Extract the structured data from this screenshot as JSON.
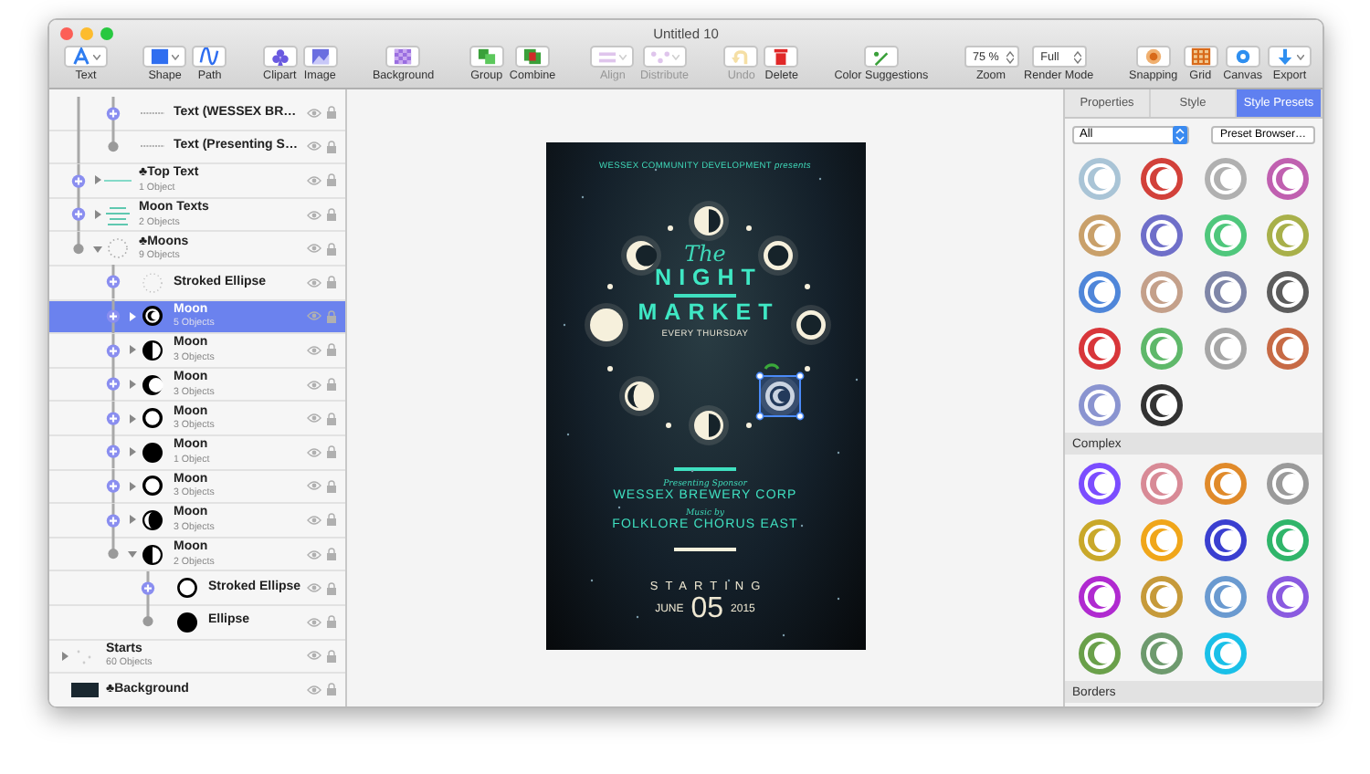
{
  "window": {
    "title": "Untitled 10"
  },
  "toolbar": [
    {
      "items": [
        {
          "kind": "dropdown",
          "label": "Text",
          "disabled": false
        }
      ]
    },
    {
      "items": [
        {
          "kind": "dropdown",
          "label": "Shape",
          "disabled": false
        },
        {
          "kind": "button",
          "label": "Path",
          "disabled": false
        }
      ]
    },
    {
      "items": [
        {
          "kind": "button",
          "label": "Clipart",
          "disabled": false
        },
        {
          "kind": "button",
          "label": "Image",
          "disabled": false
        }
      ]
    },
    {
      "items": [
        {
          "kind": "button",
          "label": "Background",
          "disabled": false
        }
      ]
    },
    {
      "items": [
        {
          "kind": "button",
          "label": "Group",
          "disabled": false
        },
        {
          "kind": "button",
          "label": "Combine",
          "disabled": false
        }
      ]
    },
    {
      "items": [
        {
          "kind": "dropdown",
          "label": "Align",
          "disabled": true
        },
        {
          "kind": "dropdown",
          "label": "Distribute",
          "disabled": true
        }
      ]
    },
    {
      "items": [
        {
          "kind": "button",
          "label": "Undo",
          "disabled": true
        },
        {
          "kind": "button",
          "label": "Delete",
          "disabled": false
        }
      ]
    },
    {
      "items": [
        {
          "kind": "button",
          "label": "Color Suggestions",
          "disabled": false
        }
      ]
    },
    {
      "items": [
        {
          "kind": "stepper",
          "label": "Zoom",
          "value": "75 %"
        },
        {
          "kind": "stepper",
          "label": "Render Mode",
          "value": "Full"
        }
      ]
    },
    {
      "items": [
        {
          "kind": "button",
          "label": "Snapping",
          "disabled": false
        },
        {
          "kind": "button",
          "label": "Grid",
          "disabled": false
        },
        {
          "kind": "button",
          "label": "Canvas",
          "disabled": false
        },
        {
          "kind": "dropdown",
          "label": "Export",
          "disabled": false
        }
      ]
    }
  ],
  "layers": [
    {
      "kind": "offscreen",
      "children": [
        {
          "kind": "offscreen",
          "children": [
            {
              "kind": "text",
              "name": "Text (WESSEX BR…",
              "selected": false
            },
            {
              "kind": "text",
              "name": "Text (Presenting S…",
              "selected": false
            }
          ]
        },
        {
          "kind": "line-group",
          "name": "♣Top Text",
          "count": "1 Object",
          "expanded": false,
          "selected": false
        },
        {
          "kind": "text-group",
          "name": "Moon Texts",
          "count": "2 Objects",
          "expanded": false,
          "selected": false
        },
        {
          "kind": "moon-group",
          "name": "♣Moons",
          "count": "9 Objects",
          "expanded": true,
          "selected": false,
          "children": [
            {
              "kind": "stroked-ellipse",
              "name": "Stroked Ellipse",
              "selected": false
            },
            {
              "kind": "moon",
              "name": "Moon",
              "count": "5 Objects",
              "expanded": false,
              "selected": true
            },
            {
              "kind": "moon",
              "name": "Moon",
              "count": "3 Objects",
              "expanded": false,
              "selected": false
            },
            {
              "kind": "moon",
              "name": "Moon",
              "count": "3 Objects",
              "expanded": false,
              "selected": false
            },
            {
              "kind": "moon",
              "name": "Moon",
              "count": "3 Objects",
              "expanded": false,
              "selected": false
            },
            {
              "kind": "moon",
              "name": "Moon",
              "count": "1 Object",
              "expanded": false,
              "selected": false
            },
            {
              "kind": "moon",
              "name": "Moon",
              "count": "3 Objects",
              "expanded": false,
              "selected": false
            },
            {
              "kind": "moon",
              "name": "Moon",
              "count": "3 Objects",
              "expanded": false,
              "selected": false
            },
            {
              "kind": "moon",
              "name": "Moon",
              "count": "2 Objects",
              "expanded": true,
              "selected": false,
              "children": [
                {
                  "kind": "ring",
                  "name": "Stroked Ellipse",
                  "selected": false
                },
                {
                  "kind": "disc",
                  "name": "Ellipse",
                  "selected": false
                }
              ]
            }
          ]
        }
      ]
    },
    {
      "kind": "stars",
      "name": "Starts",
      "count": "60 Objects",
      "expanded": false,
      "selected": false
    },
    {
      "kind": "background",
      "name": "♣Background",
      "selected": false
    }
  ],
  "canvas": {
    "poster": {
      "presenter": "WESSEX COMMUNITY DEVELOPMENT *presents*",
      "title_small": "The",
      "title_lines": [
        "NIGHT",
        "MARKET"
      ],
      "subtitle": "EVERY THURSDAY",
      "credits": [
        {
          "role": "Presenting Sponsor",
          "name": "WESSEX BREWERY CORP"
        },
        {
          "role": "Music by",
          "name": "FOLKLORE CHORUS EAST"
        }
      ],
      "date_label": "STARTING",
      "date": {
        "month": "JUNE",
        "day": "05",
        "year": "2015"
      }
    }
  },
  "inspector": {
    "tabs": [
      {
        "label": "Properties",
        "selected": false
      },
      {
        "label": "Style",
        "selected": false
      },
      {
        "label": "Style Presets",
        "selected": true
      }
    ],
    "filter": {
      "value": "All"
    },
    "browse_button": "Preset Browser…",
    "sections": [
      {
        "presets": [
          {
            "color": "#a9c4d6"
          },
          {
            "color": "#d2413a"
          },
          {
            "color": "#b0b0b0"
          },
          {
            "color": "#c060b0"
          },
          {
            "color": "#c9a06a"
          },
          {
            "color": "#6f6fc9"
          },
          {
            "color": "#4fc77c"
          },
          {
            "color": "#a8b04a"
          },
          {
            "color": "#4f86d9"
          },
          {
            "color": "#c4a08a"
          },
          {
            "color": "#7f86a8"
          },
          {
            "color": "#5c5c5c"
          },
          {
            "color": "#d8363a"
          },
          {
            "color": "#5fb86a"
          },
          {
            "color": "#a6a6a6"
          },
          {
            "color": "#c76a45"
          },
          {
            "color": "#8a94d0"
          },
          {
            "color": "#333333"
          }
        ]
      },
      {
        "title": "Complex",
        "presets": [
          {
            "color": "#7b4dff"
          },
          {
            "color": "#d88a96"
          },
          {
            "color": "#e08a2a"
          },
          {
            "color": "#9a9a9a"
          },
          {
            "color": "#c9a82a"
          },
          {
            "color": "#f0a61a"
          },
          {
            "color": "#3a3fd0"
          },
          {
            "color": "#2fb56a"
          },
          {
            "color": "#b02ad0"
          },
          {
            "color": "#c69a3a"
          },
          {
            "color": "#6a9ad0"
          },
          {
            "color": "#8a5ae0"
          },
          {
            "color": "#6aa04a"
          },
          {
            "color": "#6e9a6e"
          },
          {
            "color": "#1ac0e8"
          }
        ]
      },
      {
        "title": "Borders"
      }
    ]
  }
}
